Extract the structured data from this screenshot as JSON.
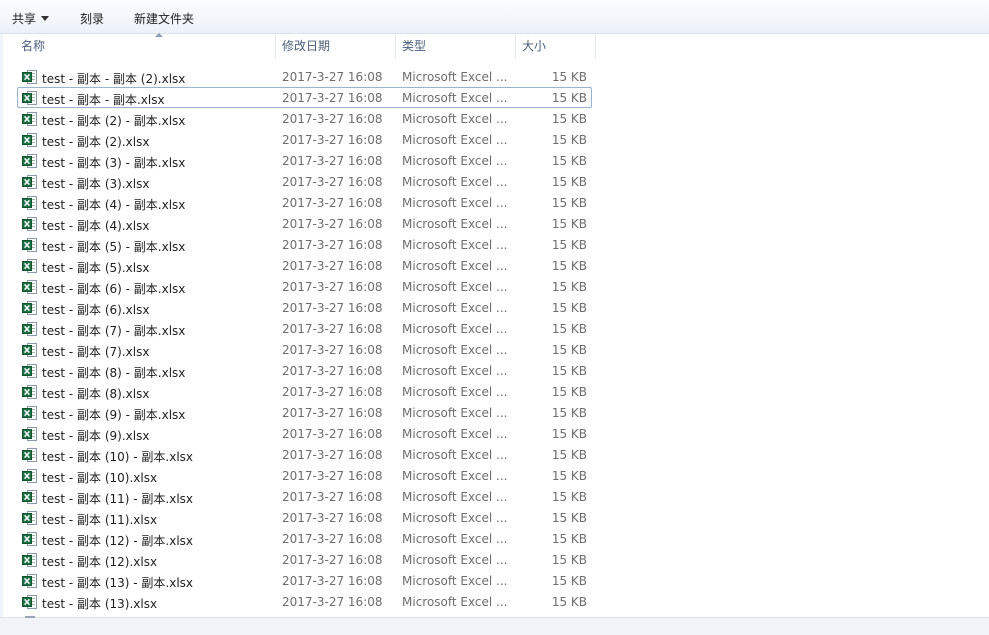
{
  "toolbar": {
    "share_label": "共享",
    "burn_label": "刻录",
    "new_folder_label": "新建文件夹"
  },
  "columns": {
    "name": "名称",
    "date": "修改日期",
    "type": "类型",
    "size": "大小"
  },
  "focused_row_index": 1,
  "files": [
    {
      "name": "test - 副本 - 副本 (2).xlsx",
      "date": "2017-3-27 16:08",
      "type": "Microsoft Excel ...",
      "size": "15 KB"
    },
    {
      "name": "test - 副本 - 副本.xlsx",
      "date": "2017-3-27 16:08",
      "type": "Microsoft Excel ...",
      "size": "15 KB"
    },
    {
      "name": "test - 副本 (2) - 副本.xlsx",
      "date": "2017-3-27 16:08",
      "type": "Microsoft Excel ...",
      "size": "15 KB"
    },
    {
      "name": "test - 副本 (2).xlsx",
      "date": "2017-3-27 16:08",
      "type": "Microsoft Excel ...",
      "size": "15 KB"
    },
    {
      "name": "test - 副本 (3) - 副本.xlsx",
      "date": "2017-3-27 16:08",
      "type": "Microsoft Excel ...",
      "size": "15 KB"
    },
    {
      "name": "test - 副本 (3).xlsx",
      "date": "2017-3-27 16:08",
      "type": "Microsoft Excel ...",
      "size": "15 KB"
    },
    {
      "name": "test - 副本 (4) - 副本.xlsx",
      "date": "2017-3-27 16:08",
      "type": "Microsoft Excel ...",
      "size": "15 KB"
    },
    {
      "name": "test - 副本 (4).xlsx",
      "date": "2017-3-27 16:08",
      "type": "Microsoft Excel ...",
      "size": "15 KB"
    },
    {
      "name": "test - 副本 (5) - 副本.xlsx",
      "date": "2017-3-27 16:08",
      "type": "Microsoft Excel ...",
      "size": "15 KB"
    },
    {
      "name": "test - 副本 (5).xlsx",
      "date": "2017-3-27 16:08",
      "type": "Microsoft Excel ...",
      "size": "15 KB"
    },
    {
      "name": "test - 副本 (6) - 副本.xlsx",
      "date": "2017-3-27 16:08",
      "type": "Microsoft Excel ...",
      "size": "15 KB"
    },
    {
      "name": "test - 副本 (6).xlsx",
      "date": "2017-3-27 16:08",
      "type": "Microsoft Excel ...",
      "size": "15 KB"
    },
    {
      "name": "test - 副本 (7) - 副本.xlsx",
      "date": "2017-3-27 16:08",
      "type": "Microsoft Excel ...",
      "size": "15 KB"
    },
    {
      "name": "test - 副本 (7).xlsx",
      "date": "2017-3-27 16:08",
      "type": "Microsoft Excel ...",
      "size": "15 KB"
    },
    {
      "name": "test - 副本 (8) - 副本.xlsx",
      "date": "2017-3-27 16:08",
      "type": "Microsoft Excel ...",
      "size": "15 KB"
    },
    {
      "name": "test - 副本 (8).xlsx",
      "date": "2017-3-27 16:08",
      "type": "Microsoft Excel ...",
      "size": "15 KB"
    },
    {
      "name": "test - 副本 (9) - 副本.xlsx",
      "date": "2017-3-27 16:08",
      "type": "Microsoft Excel ...",
      "size": "15 KB"
    },
    {
      "name": "test - 副本 (9).xlsx",
      "date": "2017-3-27 16:08",
      "type": "Microsoft Excel ...",
      "size": "15 KB"
    },
    {
      "name": "test - 副本 (10) - 副本.xlsx",
      "date": "2017-3-27 16:08",
      "type": "Microsoft Excel ...",
      "size": "15 KB"
    },
    {
      "name": "test - 副本 (10).xlsx",
      "date": "2017-3-27 16:08",
      "type": "Microsoft Excel ...",
      "size": "15 KB"
    },
    {
      "name": "test - 副本 (11) - 副本.xlsx",
      "date": "2017-3-27 16:08",
      "type": "Microsoft Excel ...",
      "size": "15 KB"
    },
    {
      "name": "test - 副本 (11).xlsx",
      "date": "2017-3-27 16:08",
      "type": "Microsoft Excel ...",
      "size": "15 KB"
    },
    {
      "name": "test - 副本 (12) - 副本.xlsx",
      "date": "2017-3-27 16:08",
      "type": "Microsoft Excel ...",
      "size": "15 KB"
    },
    {
      "name": "test - 副本 (12).xlsx",
      "date": "2017-3-27 16:08",
      "type": "Microsoft Excel ...",
      "size": "15 KB"
    },
    {
      "name": "test - 副本 (13) - 副本.xlsx",
      "date": "2017-3-27 16:08",
      "type": "Microsoft Excel ...",
      "size": "15 KB"
    },
    {
      "name": "test - 副本 (13).xlsx",
      "date": "2017-3-27 16:08",
      "type": "Microsoft Excel ...",
      "size": "15 KB"
    }
  ],
  "icons": {
    "file": "excel-file-icon",
    "share_dropdown": "caret-down-icon",
    "sort": "sort-ascending-icon"
  },
  "colors": {
    "excel_green": "#1e7145",
    "header_text": "#4c607a",
    "focus_border": "#9bb3cf"
  }
}
